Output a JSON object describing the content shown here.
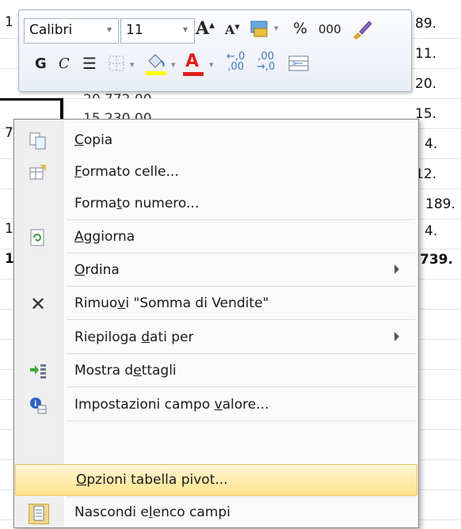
{
  "sheet": {
    "left_values": [
      "1",
      "7",
      "1",
      "1"
    ],
    "right_values": [
      "89.",
      "11.",
      "20.",
      "15.",
      "4.",
      "12.",
      "189.",
      "4.",
      "739."
    ],
    "ghost_row_1": "20.772,00",
    "ghost_row_2": "15.230,00"
  },
  "toolbar": {
    "font_name": "Calibri",
    "font_size": "11",
    "grow_font": "A",
    "shrink_font": "A",
    "percent": "%",
    "thousands": "000",
    "bold": "G",
    "italic": "C",
    "decimal_inc": "←,0",
    "decimal_inc_b": ",00",
    "decimal_dec": ",00",
    "decimal_dec_b": "→,0",
    "font_color_letter": "A",
    "fill_color": "#ffff00",
    "text_color": "#e02020"
  },
  "menu": {
    "items": [
      {
        "label_pre": "",
        "label_key": "C",
        "label_post": "opia",
        "icon": "copy-icon"
      },
      {
        "label_pre": "",
        "label_key": "F",
        "label_post": "ormato celle...",
        "icon": "format-cells-icon"
      },
      {
        "label_pre": "Forma",
        "label_key": "t",
        "label_post": "o numero...",
        "icon": ""
      },
      {
        "label_pre": "",
        "label_key": "A",
        "label_post": "ggiorna",
        "icon": "refresh-icon"
      },
      {
        "label_pre": "",
        "label_key": "O",
        "label_post": "rdina",
        "icon": ""
      },
      {
        "label_pre": "Rimuo",
        "label_key": "v",
        "label_post": "i \"Somma di Vendite\"",
        "icon": "remove-icon"
      },
      {
        "label_pre": "Riepiloga ",
        "label_key": "d",
        "label_post": "ati per",
        "icon": ""
      },
      {
        "label_pre": "Mostra d",
        "label_key": "e",
        "label_post": "ttagli",
        "icon": "show-details-icon"
      },
      {
        "label_pre": "Impostazioni campo ",
        "label_key": "v",
        "label_post": "alore...",
        "icon": "field-settings-icon"
      },
      {
        "label_pre": "",
        "label_key": "O",
        "label_post": "pzioni tabella pivot...",
        "icon": ""
      },
      {
        "label_pre": "Nascondi e",
        "label_key": "l",
        "label_post": "enco campi",
        "icon": "field-list-icon"
      }
    ]
  }
}
